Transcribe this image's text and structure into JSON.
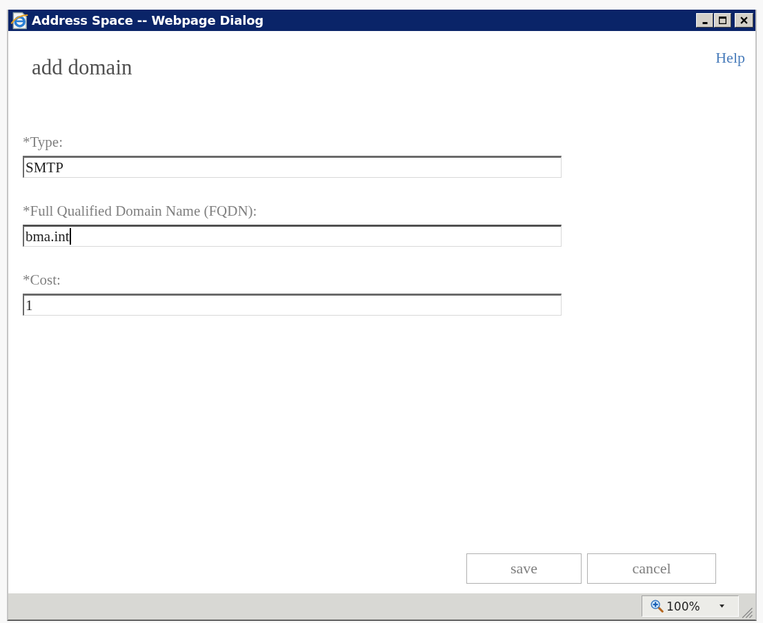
{
  "window": {
    "title": "Address Space -- Webpage Dialog"
  },
  "page": {
    "heading": "add domain",
    "help_link": "Help"
  },
  "fields": [
    {
      "label": "*Type:",
      "value": "SMTP",
      "focused": false
    },
    {
      "label": "*Full Qualified Domain Name (FQDN):",
      "value": "bma.int",
      "focused": true
    },
    {
      "label": "*Cost:",
      "value": "1",
      "focused": false
    }
  ],
  "buttons": [
    "save",
    "cancel"
  ],
  "status_bar": {
    "zoom": "100%"
  }
}
